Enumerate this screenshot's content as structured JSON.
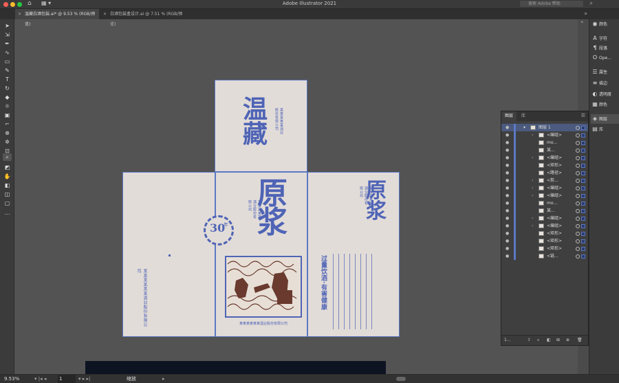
{
  "app": {
    "title": "Adobe Illustrator 2021",
    "search_placeholder": "搜索 Adobe 帮助"
  },
  "tabs": [
    {
      "label": "温藏白酒包装.ai* @ 9.53 % (RGB/预览)",
      "active": true
    },
    {
      "label": "白酒包装盒设计.ai @ 7.51 % (RGB/预览)",
      "active": false
    }
  ],
  "dock": {
    "items": [
      {
        "label": "颜色",
        "icon": "color-icon"
      },
      {
        "label": "字符",
        "icon": "character-icon"
      },
      {
        "label": "段落",
        "icon": "paragraph-icon"
      },
      {
        "label": "Ope...",
        "icon": "opentype-icon"
      },
      {
        "label": "属性",
        "icon": "properties-icon"
      },
      {
        "label": "描边",
        "icon": "stroke-icon"
      },
      {
        "label": "透明度",
        "icon": "transparency-icon"
      },
      {
        "label": "颜色",
        "icon": "swatch-icon"
      },
      {
        "label": "图层",
        "icon": "layers-icon"
      },
      {
        "label": "库",
        "icon": "library-icon"
      }
    ]
  },
  "layers_panel": {
    "tabs": [
      "图层",
      "库"
    ],
    "top_layer": "图层 1",
    "rows": [
      {
        "name": "<编组>",
        "expandable": true
      },
      {
        "name": "mo...",
        "expandable": false
      },
      {
        "name": "某...",
        "expandable": false
      },
      {
        "name": "<编组>",
        "expandable": true
      },
      {
        "name": "<矩形>",
        "expandable": false
      },
      {
        "name": "<路径>",
        "expandable": false
      },
      {
        "name": "<剪...",
        "expandable": true
      },
      {
        "name": "<编组>",
        "expandable": true
      },
      {
        "name": "<编组>",
        "expandable": true
      },
      {
        "name": "mo...",
        "expandable": false
      },
      {
        "name": "某...",
        "expandable": false
      },
      {
        "name": "<编组>",
        "expandable": true
      },
      {
        "name": "<编组>",
        "expandable": true
      },
      {
        "name": "<矩形>",
        "expandable": false
      },
      {
        "name": "<矩形>",
        "expandable": false
      },
      {
        "name": "<矩形>",
        "expandable": false
      },
      {
        "name": "<链...",
        "expandable": false
      }
    ],
    "footer_count": "1..."
  },
  "artwork": {
    "top_title": "温藏",
    "main_title": "原浆",
    "badge_number": "30",
    "badge_unit": "年",
    "side_slogan": "过量饮酒·有害健康",
    "company": "某某某某某某酒业股份有限公司",
    "company_short": "某某某某某酒业股份有限公司"
  },
  "status": {
    "zoom": "9.53%",
    "artboard": "1",
    "tool": "缩放"
  },
  "colors": {
    "accent": "#4f64b6",
    "paper": "#e2dcd8",
    "illustration": "#6a3a2e"
  }
}
